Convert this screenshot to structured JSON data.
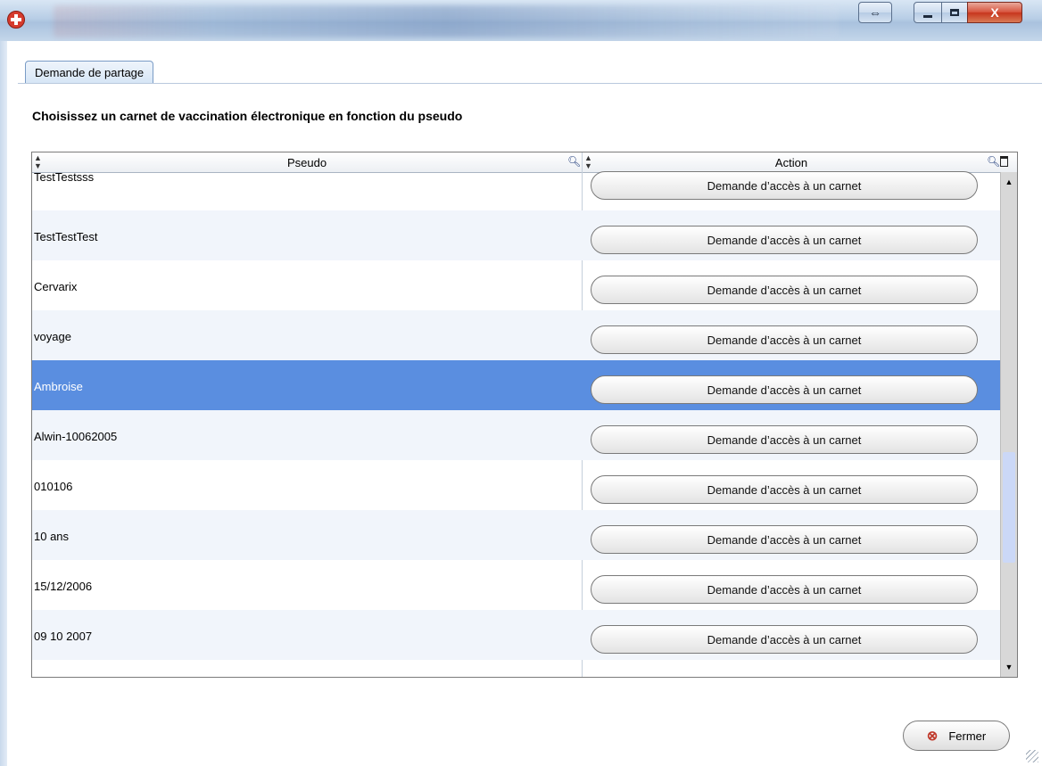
{
  "window": {
    "title": "",
    "buttons": {
      "resize": "⇔",
      "close": "X"
    }
  },
  "tab": {
    "label": "Demande de partage"
  },
  "heading": "Choisissez un carnet de vaccination électronique en fonction du pseudo",
  "table": {
    "columns": [
      "Pseudo",
      "Action"
    ],
    "rows": [
      {
        "pseudo": "TestTestsss",
        "action": "Demande d’accès à un carnet"
      },
      {
        "pseudo": "TestTestTest",
        "action": "Demande d’accès à un carnet"
      },
      {
        "pseudo": "Cervarix",
        "action": "Demande d’accès à un carnet"
      },
      {
        "pseudo": "voyage",
        "action": "Demande d’accès à un carnet"
      },
      {
        "pseudo": "Ambroise",
        "action": "Demande d’accès à un carnet",
        "selected": true
      },
      {
        "pseudo": "Alwin-10062005",
        "action": "Demande d’accès à un carnet"
      },
      {
        "pseudo": "010106",
        "action": "Demande d’accès à un carnet"
      },
      {
        "pseudo": "10 ans",
        "action": "Demande d’accès à un carnet"
      },
      {
        "pseudo": "15/12/2006",
        "action": "Demande d’accès à un carnet"
      },
      {
        "pseudo": "09 10 2007",
        "action": "Demande d’accès à un carnet"
      }
    ],
    "selected_color": "#5a8ee0"
  },
  "footer": {
    "close_label": "Fermer"
  }
}
